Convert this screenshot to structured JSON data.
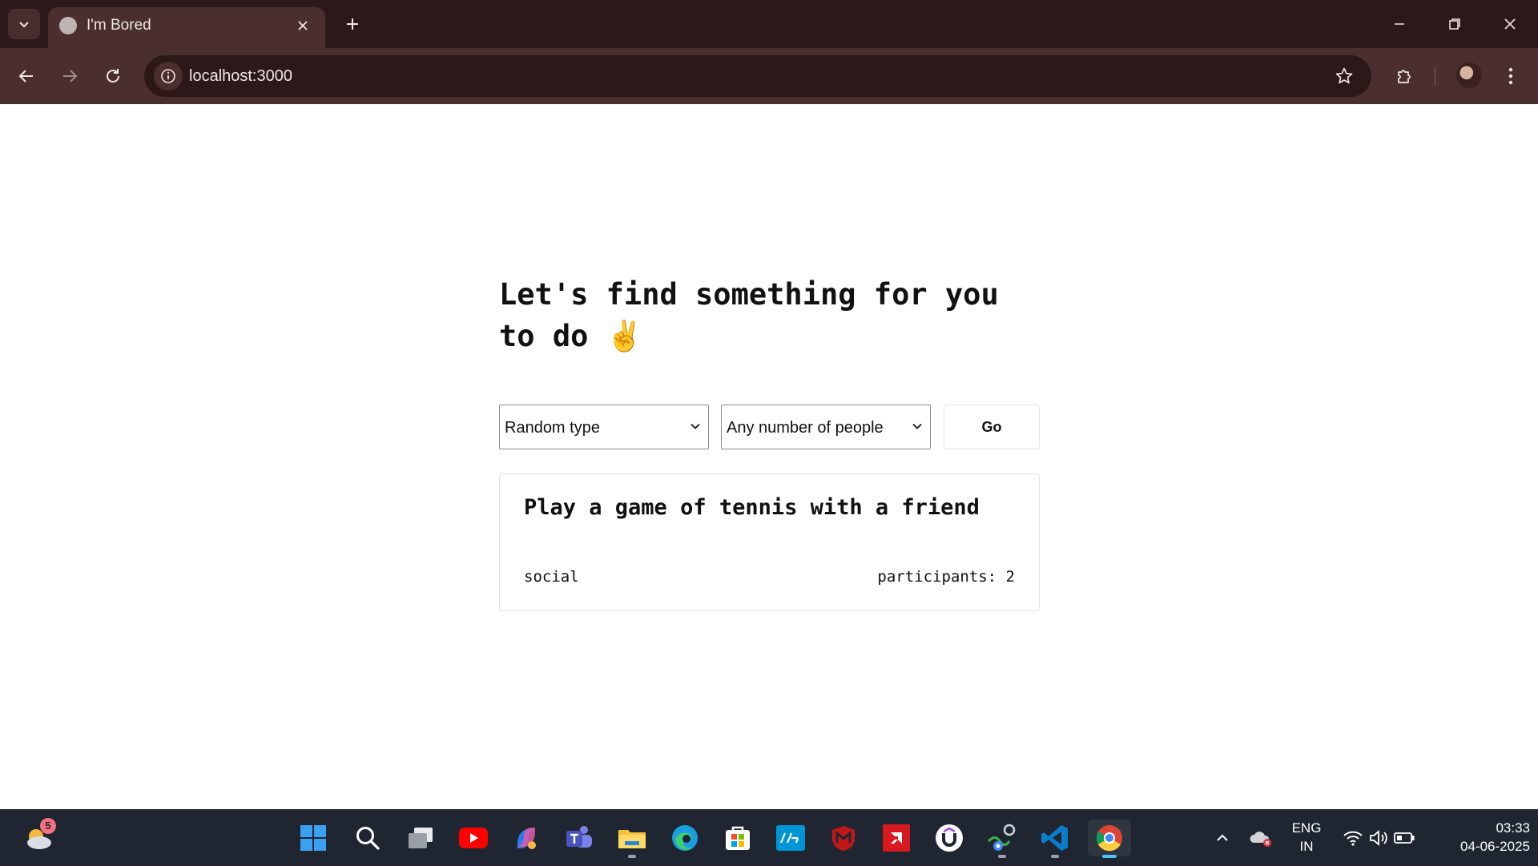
{
  "browser": {
    "tab_title": "I'm Bored",
    "url": "localhost:3000"
  },
  "page": {
    "heading": "Let's find something for you to do",
    "heading_emoji": "✌️",
    "type_select": {
      "value": "Random type"
    },
    "people_select": {
      "value": "Any number of people"
    },
    "go_label": "Go",
    "result": {
      "activity": "Play a game of tennis with a friend",
      "type": "social",
      "participants_label": "participants:",
      "participants": "2"
    }
  },
  "taskbar": {
    "weather_badge": "5",
    "language": "ENG",
    "region": "IN",
    "time": "03:33",
    "date": "04-06-2025",
    "icons": [
      "weather-icon",
      "windows-start-icon",
      "search-icon",
      "task-view-icon",
      "youtube-icon",
      "copilot-icon",
      "teams-icon",
      "file-explorer-icon",
      "edge-icon",
      "microsoft-store-icon",
      "myhp-icon",
      "mcafee-icon",
      "amd-icon",
      "udemy-icon",
      "chrome-beta-icon",
      "vscode-icon",
      "chrome-icon"
    ]
  },
  "colors": {
    "titlebar": "#2d1819",
    "toolbar": "#4b2f30",
    "taskbar": "#1f2631",
    "accent_blue": "#4cc2ff"
  }
}
